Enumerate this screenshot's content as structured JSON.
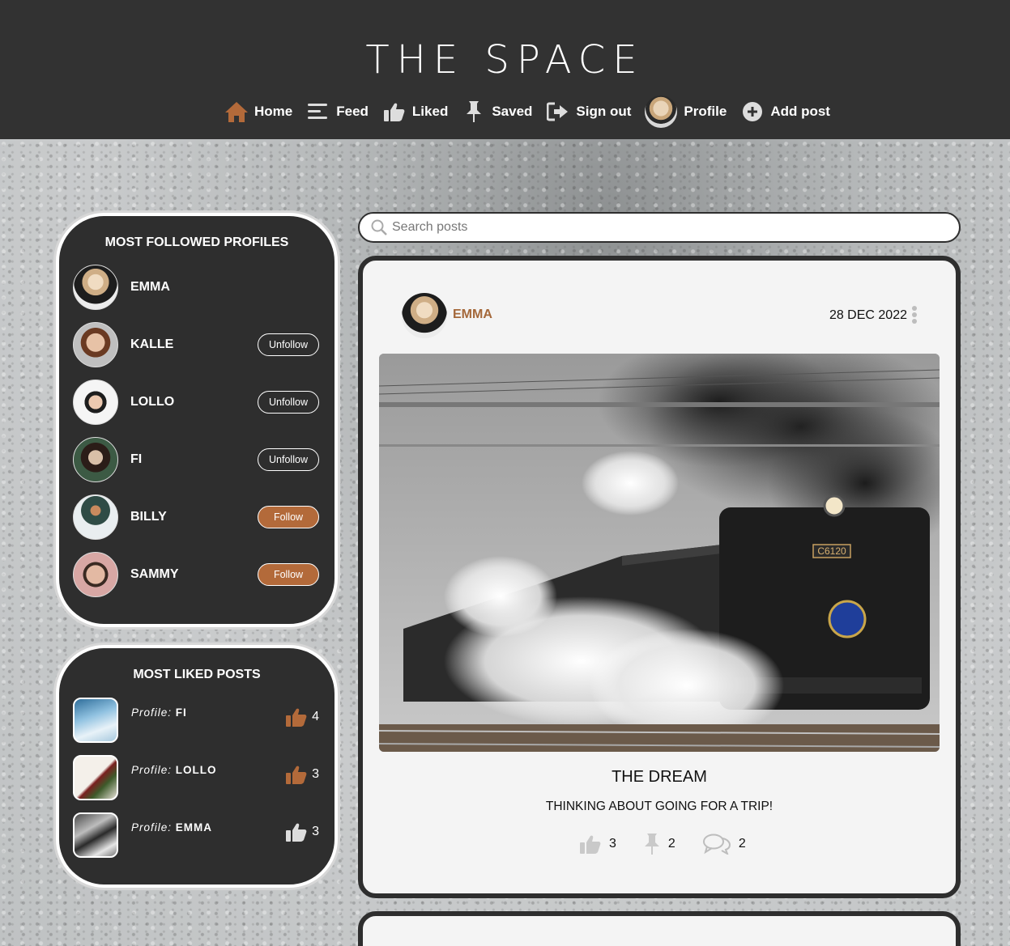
{
  "app": {
    "brand": "THE SPACE"
  },
  "colors": {
    "accent": "#b36a3a",
    "header_bg": "#323232",
    "panel_bg": "#2e2e2e",
    "author": "#a4683a"
  },
  "nav": {
    "home": {
      "label": "Home",
      "icon": "home-icon"
    },
    "feed": {
      "label": "Feed",
      "icon": "feed-icon"
    },
    "liked": {
      "label": "Liked",
      "icon": "thumbs-up-icon"
    },
    "saved": {
      "label": "Saved",
      "icon": "pin-icon"
    },
    "signout": {
      "label": "Sign out",
      "icon": "sign-out-icon"
    },
    "profile": {
      "label": "Profile",
      "icon": "avatar"
    },
    "addpost": {
      "label": "Add post",
      "icon": "plus-circle-icon"
    }
  },
  "most_followed": {
    "title": "MOST FOLLOWED PROFILES",
    "profiles": [
      {
        "name": "EMMA",
        "button": ""
      },
      {
        "name": "KALLE",
        "button": "Unfollow"
      },
      {
        "name": "LOLLO",
        "button": "Unfollow"
      },
      {
        "name": "FI",
        "button": "Unfollow"
      },
      {
        "name": "BILLY",
        "button": "Follow"
      },
      {
        "name": "SAMMY",
        "button": "Follow"
      }
    ]
  },
  "most_liked": {
    "title": "MOST LIKED POSTS",
    "profile_prefix": "Profile:",
    "posts": [
      {
        "profile": "FI",
        "likes": "4"
      },
      {
        "profile": "LOLLO",
        "likes": "3"
      },
      {
        "profile": "EMMA",
        "likes": "3"
      }
    ]
  },
  "search": {
    "placeholder": "Search posts",
    "value": ""
  },
  "post": {
    "author": "EMMA",
    "date": "28 DEC 2022",
    "title": "THE DREAM",
    "text": "THINKING ABOUT GOING FOR A TRIP!",
    "likes": "3",
    "saves": "2",
    "comments": "2",
    "image_alt": "steam locomotive",
    "locomotive_plate": "C6120"
  }
}
